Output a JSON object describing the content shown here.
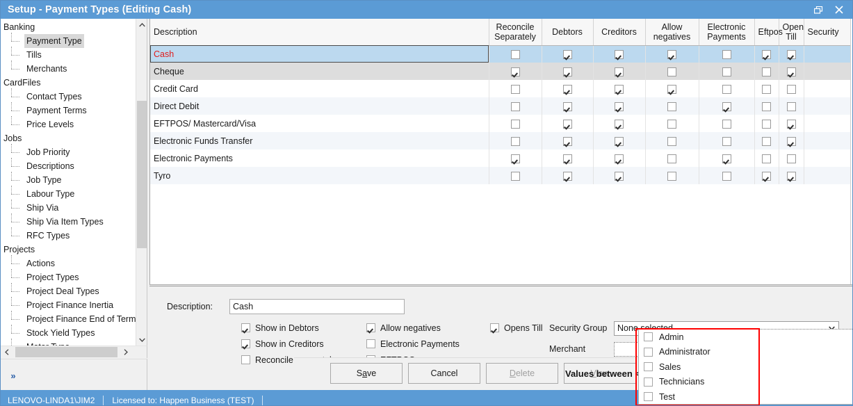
{
  "window": {
    "title": "Setup - Payment Types (Editing Cash)",
    "restore_tooltip": "Restore",
    "close_tooltip": "Close"
  },
  "tree": {
    "groups": [
      {
        "label": "Banking",
        "items": [
          "Payment Type",
          "Tills",
          "Merchants"
        ]
      },
      {
        "label": "CardFiles",
        "items": [
          "Contact Types",
          "Payment Terms",
          "Price Levels"
        ]
      },
      {
        "label": "Jobs",
        "items": [
          "Job Priority",
          "Descriptions",
          "Job Type",
          "Labour Type",
          "Ship Via",
          "Ship Via Item Types",
          "RFC Types"
        ]
      },
      {
        "label": "Projects",
        "items": [
          "Actions",
          "Project Types",
          "Project Deal Types",
          "Project Finance Inertia",
          "Project Finance End of Term",
          "Stock Yield Types",
          "Motor Type"
        ]
      }
    ],
    "selected": "Payment Type",
    "scroll_up_icon": "chevron-up-icon",
    "scroll_down_icon": "chevron-down-icon",
    "scroll_left_icon": "chevron-left-icon",
    "scroll_right_icon": "chevron-right-icon",
    "expand_label": "»"
  },
  "grid": {
    "columns": [
      "Description",
      "Reconcile Separately",
      "Debtors",
      "Creditors",
      "Allow negatives",
      "Electronic Payments",
      "Eftpos",
      "Open Till",
      "Security"
    ],
    "rows": [
      {
        "description": "Cash",
        "reconcile_separately": false,
        "debtors": true,
        "creditors": true,
        "allow_negatives": true,
        "electronic_payments": false,
        "eftpos": true,
        "open_till": true,
        "security": "",
        "selected": true,
        "style": "sel"
      },
      {
        "description": "Cheque",
        "reconcile_separately": true,
        "debtors": true,
        "creditors": true,
        "allow_negatives": false,
        "electronic_payments": false,
        "eftpos": false,
        "open_till": true,
        "security": "",
        "selected": false,
        "style": "grey"
      },
      {
        "description": "Credit Card",
        "reconcile_separately": false,
        "debtors": true,
        "creditors": true,
        "allow_negatives": true,
        "electronic_payments": false,
        "eftpos": false,
        "open_till": false,
        "security": "",
        "selected": false,
        "style": "white"
      },
      {
        "description": "Direct Debit",
        "reconcile_separately": false,
        "debtors": true,
        "creditors": true,
        "allow_negatives": false,
        "electronic_payments": true,
        "eftpos": false,
        "open_till": false,
        "security": "",
        "selected": false,
        "style": "alt"
      },
      {
        "description": "EFTPOS/ Mastercard/Visa",
        "reconcile_separately": false,
        "debtors": true,
        "creditors": true,
        "allow_negatives": false,
        "electronic_payments": false,
        "eftpos": false,
        "open_till": true,
        "security": "",
        "selected": false,
        "style": "white"
      },
      {
        "description": "Electronic Funds Transfer",
        "reconcile_separately": false,
        "debtors": true,
        "creditors": true,
        "allow_negatives": false,
        "electronic_payments": false,
        "eftpos": false,
        "open_till": true,
        "security": "",
        "selected": false,
        "style": "alt"
      },
      {
        "description": "Electronic Payments",
        "reconcile_separately": true,
        "debtors": true,
        "creditors": true,
        "allow_negatives": false,
        "electronic_payments": true,
        "eftpos": false,
        "open_till": false,
        "security": "",
        "selected": false,
        "style": "white"
      },
      {
        "description": "Tyro",
        "reconcile_separately": false,
        "debtors": true,
        "creditors": true,
        "allow_negatives": false,
        "electronic_payments": false,
        "eftpos": true,
        "open_till": true,
        "security": "",
        "selected": false,
        "style": "alt"
      }
    ]
  },
  "form": {
    "description_label": "Description:",
    "description_value": "Cash",
    "checkboxes_col1": [
      {
        "label": "Show in Debtors",
        "checked": true
      },
      {
        "label": "Show in Creditors",
        "checked": true
      },
      {
        "label": "Reconcile separately",
        "checked": false
      }
    ],
    "checkboxes_col2": [
      {
        "label": "Allow negatives",
        "checked": true
      },
      {
        "label": "Electronic Payments",
        "checked": false
      },
      {
        "label": "EFTPOS",
        "checked": true
      }
    ],
    "checkboxes_col3": [
      {
        "label": "Opens Till",
        "checked": true
      }
    ],
    "security_group_label": "Security Group",
    "security_group_value": "None selected",
    "merchant_label": "Merchant",
    "merchant_value": "",
    "dropdown_arrow_icon": "chevron-down-icon"
  },
  "dropdown": {
    "open": true,
    "options": [
      {
        "label": "Admin",
        "checked": false
      },
      {
        "label": "Administrator",
        "checked": false
      },
      {
        "label": "Sales",
        "checked": false
      },
      {
        "label": "Technicians",
        "checked": false
      },
      {
        "label": "Test",
        "checked": false
      }
    ]
  },
  "buttons": {
    "save": {
      "pre": "S",
      "accel": "a",
      "post": "ve",
      "disabled": false
    },
    "cancel": {
      "pre": "Cancel",
      "accel": "",
      "post": "",
      "disabled": false
    },
    "delete": {
      "pre": "",
      "accel": "D",
      "post": "elete",
      "disabled": true
    },
    "view": {
      "pre": "",
      "accel": "V",
      "post": "iew",
      "disabled": true
    },
    "hint": "Values between < > indicate system default"
  },
  "statusbar": {
    "machine": "LENOVO-LINDA1\\JIM2",
    "license": "Licensed to: Happen Business (TEST)"
  },
  "colors": {
    "title_bar": "#5b9bd5",
    "selected_row": "#bcd9ef",
    "selected_text": "#e01b1b",
    "grey_row": "#dddddd",
    "alt_row": "#f3f6fa",
    "highlight_box": "#ff0000",
    "panel": "#f0f0f0"
  }
}
